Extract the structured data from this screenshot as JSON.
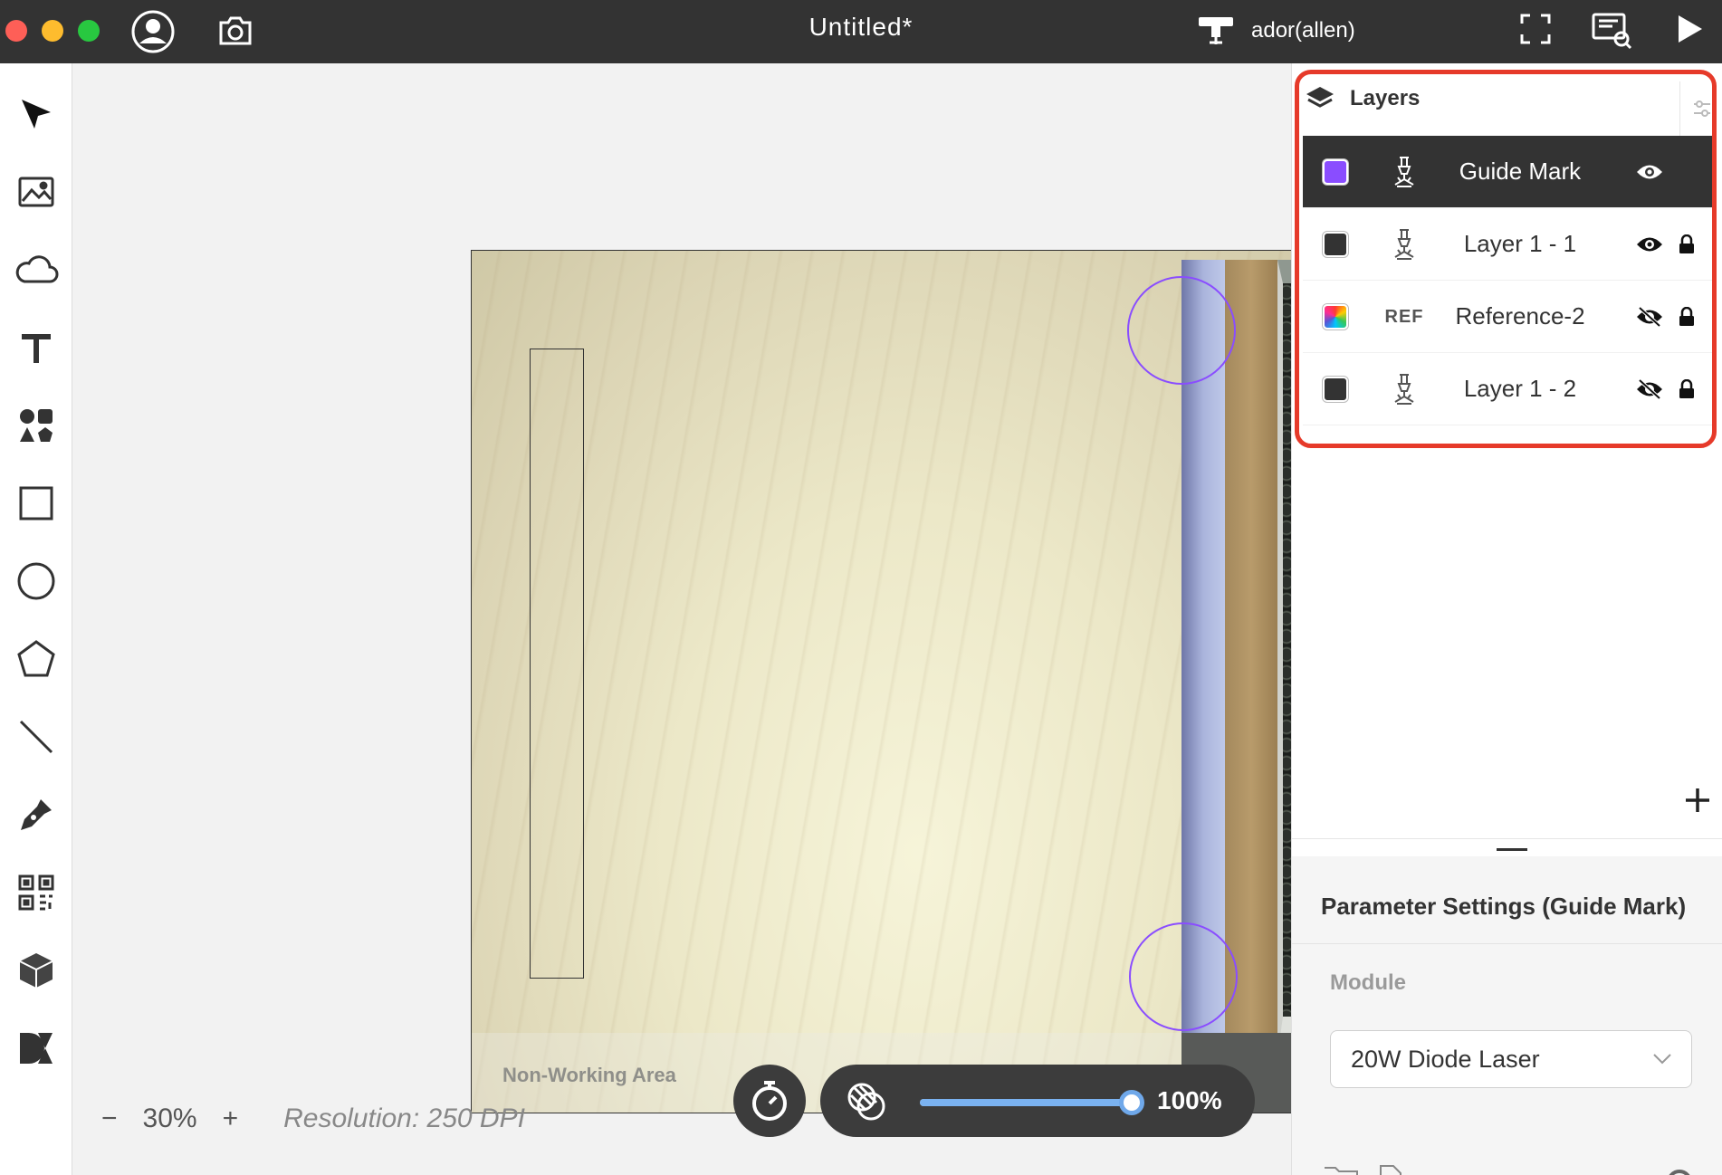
{
  "window": {
    "title": "Untitled*",
    "device_name": "ador(allen)"
  },
  "colors": {
    "titlebar": "#333333",
    "accent_highlight": "#e63a2a",
    "guide_mark": "#8a4dff",
    "slider": "#7ab2f0"
  },
  "toolbar": {
    "tools": [
      "select-arrow",
      "image",
      "cloud-import",
      "text",
      "element-shapes",
      "rectangle",
      "ellipse",
      "polygon",
      "line",
      "pen",
      "qr-code",
      "box-generator",
      "dxf-mark"
    ]
  },
  "canvas": {
    "non_working_area_label": "Non-Working Area"
  },
  "zoom": {
    "minus_label": "−",
    "value": "30%",
    "plus_label": "+",
    "resolution": "Resolution: 250 DPI"
  },
  "opacity": {
    "value_label": "100%",
    "fraction": 1.0
  },
  "layers": {
    "header": "Layers",
    "items": [
      {
        "name": "Guide Mark",
        "color": "#8a4dff",
        "module": "laser-head",
        "visible": true,
        "locked": false,
        "selected": true
      },
      {
        "name": "Layer 1 - 1",
        "color": "#333333",
        "module": "laser-head",
        "visible": true,
        "locked": true,
        "selected": false
      },
      {
        "name": "Reference-2",
        "color": "rainbow",
        "module": "REF",
        "visible": false,
        "locked": true,
        "selected": false
      },
      {
        "name": "Layer 1 - 2",
        "color": "#333333",
        "module": "laser-head",
        "visible": false,
        "locked": true,
        "selected": false
      }
    ]
  },
  "parameters": {
    "title": "Parameter Settings (Guide Mark)",
    "module_label": "Module",
    "module_value": "20W Diode Laser"
  }
}
